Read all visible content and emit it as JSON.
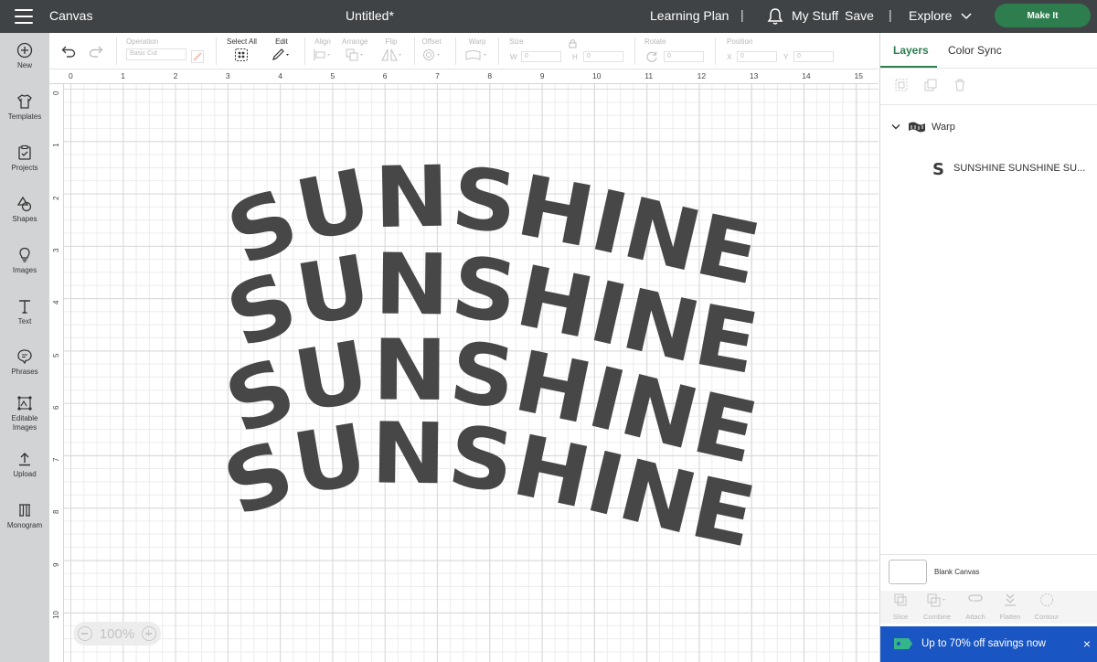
{
  "topbar": {
    "menu_icon": "hamburger-icon",
    "app_name": "Canvas",
    "doc_title": "Untitled*",
    "learning_plan": "Learning Plan",
    "separator": "|",
    "notifications_icon": "bell-icon",
    "my_stuff": "My Stuff",
    "save": "Save",
    "explore": "Explore",
    "make_it": "Make It",
    "accent_color": "#2e7d4f"
  },
  "leftbar": {
    "items": [
      {
        "label": "New",
        "icon": "plus-circle-icon"
      },
      {
        "label": "Templates",
        "icon": "tshirt-icon"
      },
      {
        "label": "Projects",
        "icon": "projects-icon"
      },
      {
        "label": "Shapes",
        "icon": "shapes-icon"
      },
      {
        "label": "Images",
        "icon": "lightbulb-icon"
      },
      {
        "label": "Text",
        "icon": "text-icon"
      },
      {
        "label": "Phrases",
        "icon": "speech-bubble-icon"
      },
      {
        "label": "Editable",
        "label2": "Images",
        "icon": "editable-images-icon"
      },
      {
        "label": "Upload",
        "icon": "upload-icon"
      },
      {
        "label": "Monogram",
        "icon": "monogram-icon"
      }
    ]
  },
  "toolbar": {
    "operation_label": "Operation",
    "operation_value": "Basic Cut",
    "select_all_label": "Select All",
    "edit_label": "Edit",
    "align_label": "Align",
    "arrange_label": "Arrange",
    "flip_label": "Flip",
    "offset_label": "Offset",
    "warp_label": "Warp",
    "size_label": "Size",
    "w_label": "W",
    "h_label": "H",
    "w_value": "0",
    "h_value": "0",
    "rotate_label": "Rotate",
    "rotate_value": "0",
    "position_label": "Position",
    "x_label": "X",
    "y_label": "Y",
    "x_value": "0",
    "y_value": "0"
  },
  "rulers": {
    "horizontal": [
      "0",
      "1",
      "2",
      "3",
      "4",
      "5",
      "6",
      "7",
      "8",
      "9",
      "10",
      "11",
      "12",
      "13",
      "14",
      "15"
    ],
    "vertical": [
      "0",
      "1",
      "2",
      "3",
      "4",
      "5",
      "6",
      "7",
      "8",
      "9",
      "10"
    ]
  },
  "canvas": {
    "design_text": "SUNSHINE",
    "text_color": "#474747"
  },
  "zoom": {
    "value": "100%"
  },
  "layers_panel": {
    "tabs": [
      "Layers",
      "Color Sync"
    ],
    "group_name": "Warp",
    "group_icon": "warp-flag-icon",
    "layer_name": "SUNSHINE SUNSHINE SU...",
    "layer_icon": "text-s-icon",
    "blank_canvas": "Blank Canvas",
    "actions": [
      "Slice",
      "Combine",
      "Attach",
      "Flatten",
      "Contour"
    ]
  },
  "promo": {
    "text": "Up to 70% off savings now",
    "close": "×",
    "color": "#1a56c3"
  }
}
